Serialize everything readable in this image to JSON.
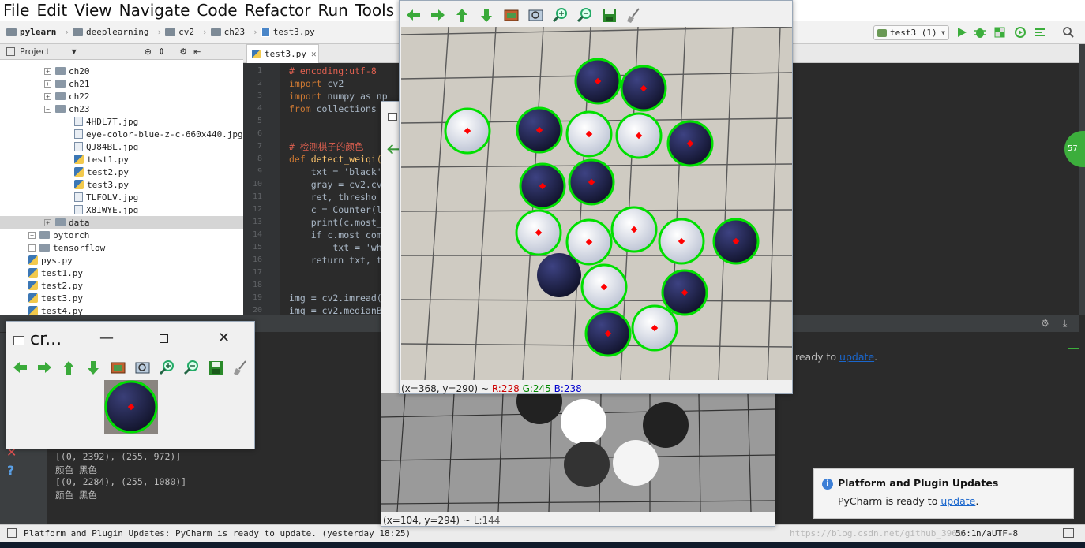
{
  "menu": [
    "File",
    "Edit",
    "View",
    "Navigate",
    "Code",
    "Refactor",
    "Run",
    "Tools",
    "V"
  ],
  "breadcrumb": [
    "pylearn",
    "deeplearning",
    "cv2",
    "ch23",
    "test3.py"
  ],
  "run_config": "test3 (1)",
  "project": {
    "label": "Project",
    "items": [
      "ch20",
      "ch21",
      "ch22",
      "ch23",
      "4HDL7T.jpg",
      "eye-color-blue-z-c-660x440.jpg",
      "QJ84BL.jpg",
      "test1.py",
      "test2.py",
      "test3.py",
      "TLFOLV.jpg",
      "X8IWYE.jpg",
      "data",
      "pytorch",
      "tensorflow",
      "pys.py",
      "test1.py",
      "test2.py",
      "test3.py",
      "test4.py"
    ]
  },
  "editor": {
    "tab": "test3.py",
    "lines": [
      "1",
      "2",
      "3",
      "4",
      "5",
      "6",
      "7",
      "8",
      "9",
      "10",
      "11",
      "12",
      "13",
      "14",
      "15",
      "16",
      "17",
      "18",
      "19",
      "20"
    ],
    "code": [
      {
        "k": "cm",
        "t": "# encoding:utf-8"
      },
      {
        "k": "kw",
        "t": "import",
        "r": " cv2"
      },
      {
        "k": "kw",
        "t": "import",
        "r": " numpy as np"
      },
      {
        "k": "kw",
        "t": "from",
        "r": " collections"
      },
      {
        "k": "",
        "t": ""
      },
      {
        "k": "",
        "t": ""
      },
      {
        "k": "cm",
        "t": "# 检测棋子的颜色"
      },
      {
        "k": "kw",
        "t": "def",
        "r": " detect_weiqi("
      },
      {
        "k": "",
        "t": "    txt = 'black'"
      },
      {
        "k": "",
        "t": "    gray = cv2.cv"
      },
      {
        "k": "",
        "t": "    ret, thresho"
      },
      {
        "k": "",
        "t": "    c = Counter(l"
      },
      {
        "k": "",
        "t": "    print(c.most_"
      },
      {
        "k": "",
        "t": "    if c.most_com"
      },
      {
        "k": "",
        "t": "        txt = 'wh"
      },
      {
        "k": "",
        "t": "    return txt, t"
      },
      {
        "k": "",
        "t": ""
      },
      {
        "k": "",
        "t": ""
      },
      {
        "k": "",
        "t": "img = cv2.imread("
      },
      {
        "k": "",
        "t": "img = cv2.medianB"
      }
    ]
  },
  "run_output": [
    "[(0, 2392), (255, 972)]",
    "颜色 黑色",
    "[(0, 2284), (255, 1080)]",
    "颜色 黑色"
  ],
  "bg_ready": {
    "prefix": "ready to ",
    "link": "update",
    "suffix": "."
  },
  "status_bar": {
    "message": "Platform and Plugin Updates: PyCharm is ready to update. (yesterday 18:25)",
    "pos": "56:1",
    "sep": "n/a",
    "enc": "UTF-8",
    "watermark": "https://blog.csdn.net/github_3961"
  },
  "notification": {
    "title": "Platform and Plugin Updates",
    "body_prefix": "PyCharm is ready to ",
    "link": "update",
    "body_suffix": "."
  },
  "crop_window": {
    "title": "cr..."
  },
  "main_window": {
    "status": {
      "coords": "(x=368, y=290) ~",
      "r": "R:228",
      "g": "G:245",
      "b": "B:238"
    }
  },
  "gray_window": {
    "status": {
      "coords": "(x=104, y=294) ~",
      "l": "L:144"
    }
  },
  "colors": {
    "accent_green": "#00e000",
    "marker_red": "#ff0000",
    "r": "#cc0000",
    "g": "#008800",
    "b": "#0000cc"
  },
  "toolbar_icons": [
    "arrow-left-icon",
    "arrow-right-icon",
    "arrow-up-icon",
    "arrow-down-icon",
    "image-icon",
    "zoom-fit-icon",
    "zoom-in-icon",
    "zoom-out-icon",
    "save-icon",
    "clear-icon"
  ],
  "stones": [
    {
      "c": "black",
      "n": 1
    },
    {
      "c": "black",
      "n": 2
    },
    {
      "c": "white",
      "n": 3
    },
    {
      "c": "black",
      "n": 4
    },
    {
      "c": "white",
      "n": 5
    },
    {
      "c": "white",
      "n": 6
    },
    {
      "c": "black",
      "n": 7
    },
    {
      "c": "black",
      "n": 8
    },
    {
      "c": "black",
      "n": 9
    },
    {
      "c": "white",
      "n": 10
    },
    {
      "c": "white",
      "n": 11
    },
    {
      "c": "white",
      "n": 12
    },
    {
      "c": "white",
      "n": 13
    },
    {
      "c": "black",
      "n": 14
    },
    {
      "c": "white",
      "n": 15
    },
    {
      "c": "black",
      "n": 16
    },
    {
      "c": "black",
      "n": 17
    },
    {
      "c": "white",
      "n": 18
    }
  ]
}
